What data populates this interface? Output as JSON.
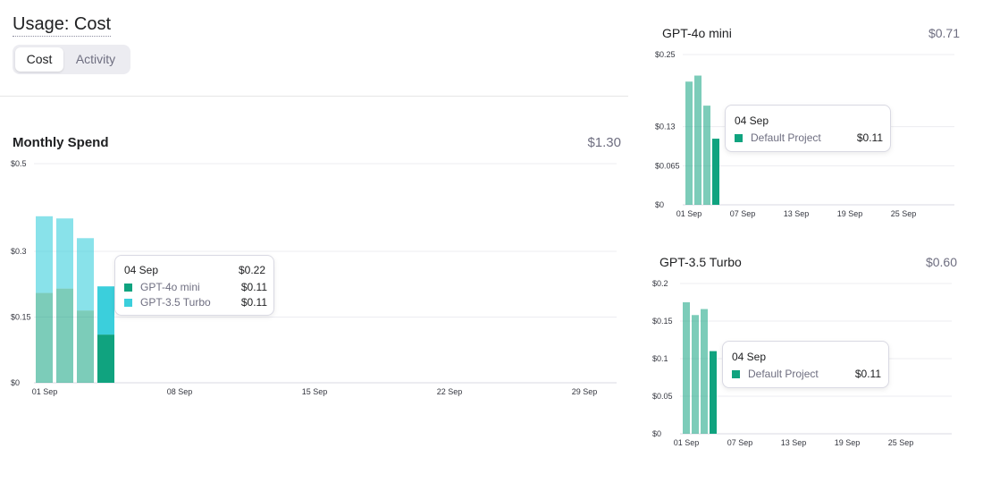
{
  "page": {
    "title": "Usage: Cost",
    "tabs": [
      {
        "label": "Cost",
        "active": true
      },
      {
        "label": "Activity",
        "active": false
      }
    ]
  },
  "colors": {
    "gpt4o_mini": "#10a37f",
    "gpt35_turbo": "#3bcfdc",
    "grid": "#ececf1",
    "axis": "#d9d9e3"
  },
  "monthly": {
    "title": "Monthly Spend",
    "total": "$1.30",
    "tooltip": {
      "date": "04 Sep",
      "total": "$0.22",
      "rows": [
        {
          "label": "GPT-4o mini",
          "value": "$0.11",
          "color": "#10a37f"
        },
        {
          "label": "GPT-3.5 Turbo",
          "value": "$0.11",
          "color": "#3bcfdc"
        }
      ]
    }
  },
  "gpt4o": {
    "title": "GPT-4o mini",
    "total": "$0.71",
    "tooltip": {
      "date": "04 Sep",
      "rows": [
        {
          "label": "Default Project",
          "value": "$0.11",
          "color": "#10a37f"
        }
      ]
    }
  },
  "gpt35": {
    "title": "GPT-3.5 Turbo",
    "total": "$0.60",
    "tooltip": {
      "date": "04 Sep",
      "rows": [
        {
          "label": "Default Project",
          "value": "$0.11",
          "color": "#10a37f"
        }
      ]
    }
  },
  "chart_data": [
    {
      "type": "bar",
      "stacked": true,
      "title": "Monthly Spend",
      "categories": [
        "01 Sep",
        "02 Sep",
        "03 Sep",
        "04 Sep"
      ],
      "series": [
        {
          "name": "GPT-4o mini",
          "values": [
            0.205,
            0.215,
            0.165,
            0.11
          ]
        },
        {
          "name": "GPT-3.5 Turbo",
          "values": [
            0.175,
            0.16,
            0.165,
            0.11
          ]
        }
      ],
      "highlight_index": 3,
      "yticks": [
        0,
        0.15,
        0.3,
        0.5
      ],
      "ytick_labels": [
        "$0",
        "$0.15",
        "$0.3",
        "$0.5"
      ],
      "xticks": [
        "01 Sep",
        "08 Sep",
        "15 Sep",
        "22 Sep",
        "29 Sep"
      ],
      "ylim": [
        0,
        0.5
      ]
    },
    {
      "type": "bar",
      "title": "GPT-4o mini",
      "categories": [
        "01 Sep",
        "02 Sep",
        "03 Sep",
        "04 Sep"
      ],
      "series": [
        {
          "name": "Default Project",
          "values": [
            0.205,
            0.215,
            0.165,
            0.11
          ]
        }
      ],
      "highlight_index": 3,
      "yticks": [
        0,
        0.065,
        0.13,
        0.25
      ],
      "ytick_labels": [
        "$0",
        "$0.065",
        "$0.13",
        "$0.25"
      ],
      "xticks": [
        "01 Sep",
        "07 Sep",
        "13 Sep",
        "19 Sep",
        "25 Sep"
      ],
      "ylim": [
        0,
        0.25
      ]
    },
    {
      "type": "bar",
      "title": "GPT-3.5 Turbo",
      "categories": [
        "01 Sep",
        "02 Sep",
        "03 Sep",
        "04 Sep"
      ],
      "series": [
        {
          "name": "Default Project",
          "values": [
            0.175,
            0.158,
            0.166,
            0.11
          ]
        }
      ],
      "highlight_index": 3,
      "yticks": [
        0,
        0.05,
        0.1,
        0.15,
        0.2
      ],
      "ytick_labels": [
        "$0",
        "$0.05",
        "$0.1",
        "$0.15",
        "$0.2"
      ],
      "xticks": [
        "01 Sep",
        "07 Sep",
        "13 Sep",
        "19 Sep",
        "25 Sep"
      ],
      "ylim": [
        0,
        0.2
      ]
    }
  ]
}
